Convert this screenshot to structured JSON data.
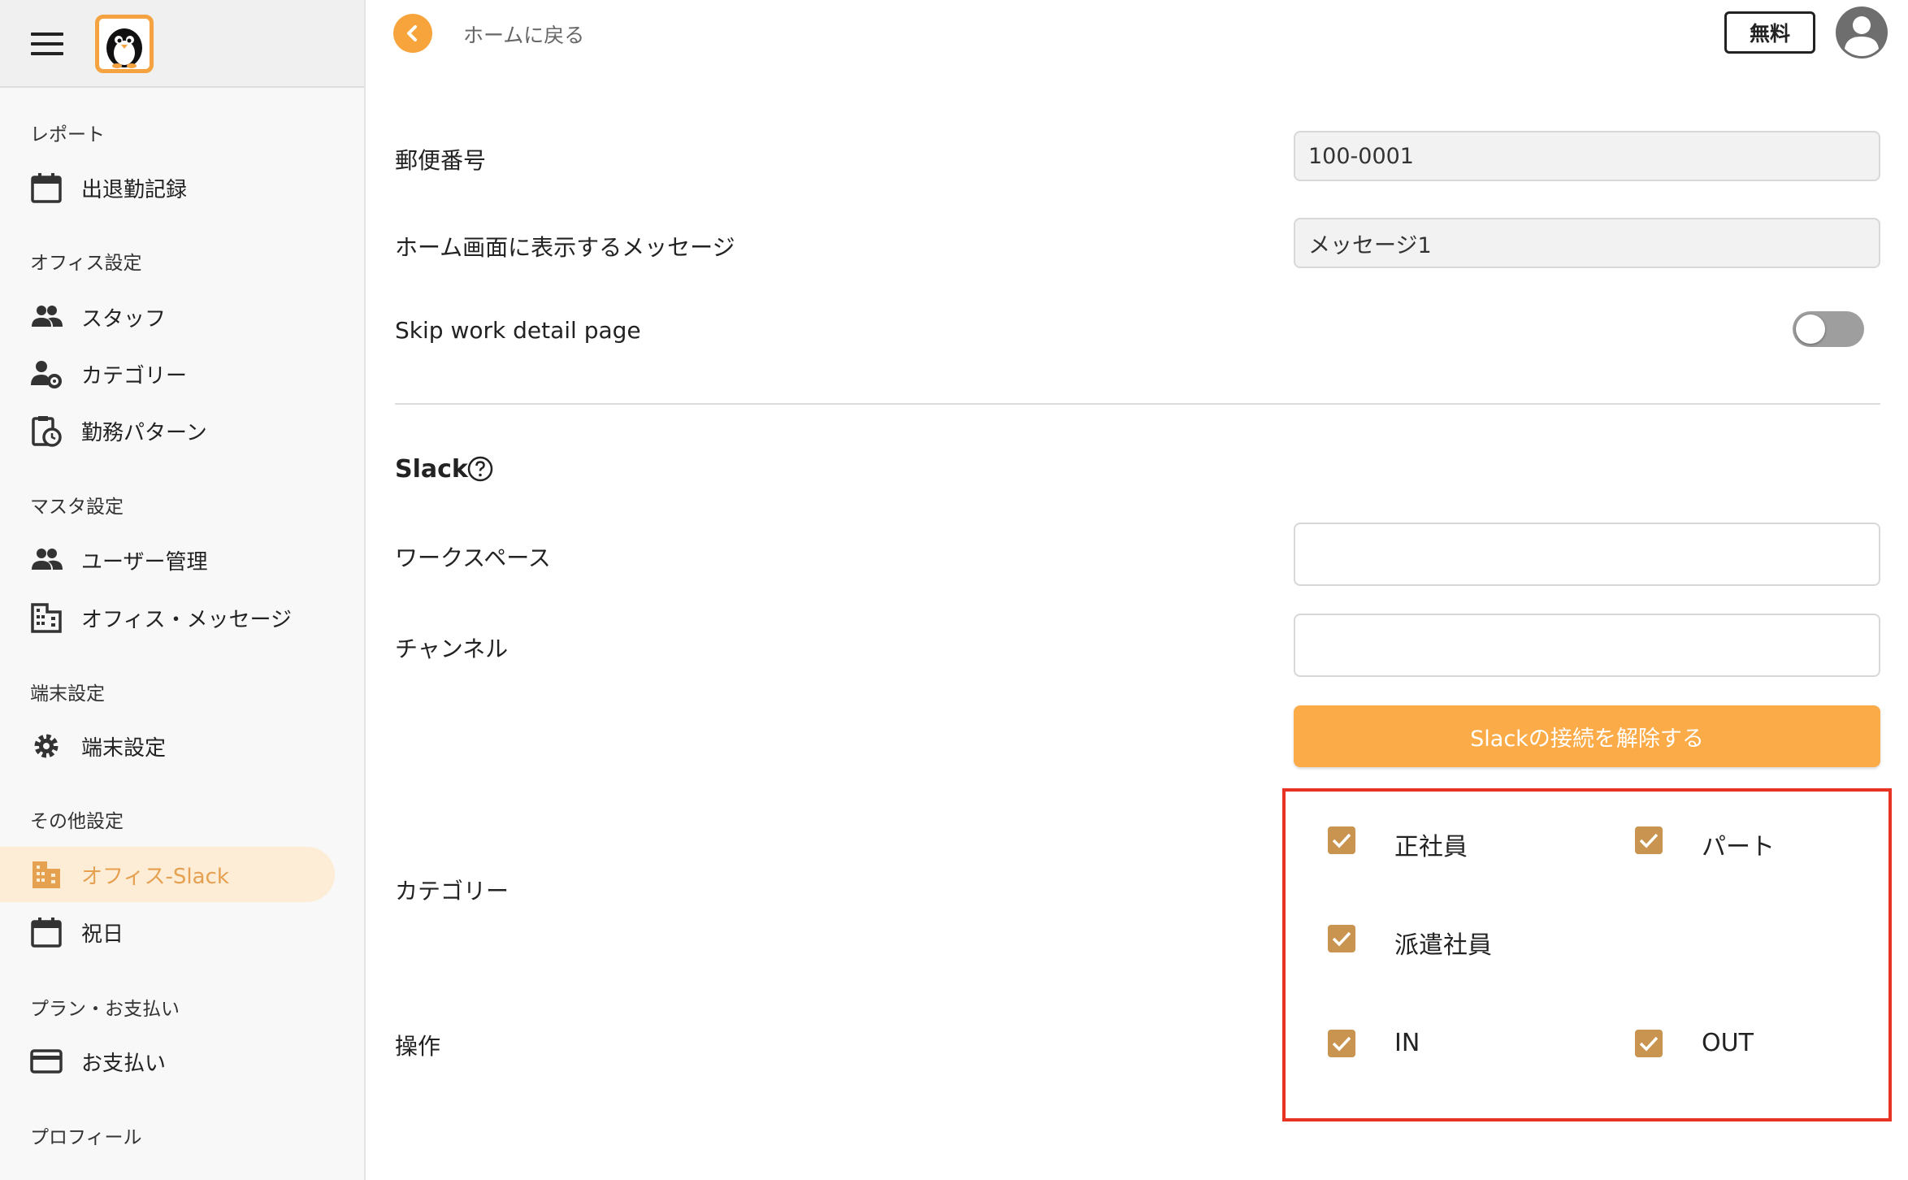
{
  "sidebar": {
    "sections": [
      {
        "label": "レポート"
      },
      {
        "label": "オフィス設定"
      },
      {
        "label": "マスタ設定"
      },
      {
        "label": "端末設定"
      },
      {
        "label": "その他設定"
      },
      {
        "label": "プラン・お支払い"
      },
      {
        "label": "プロフィール"
      }
    ],
    "items": [
      {
        "label": "出退勤記録",
        "icon": "calendar-icon"
      },
      {
        "label": "スタッフ",
        "icon": "people-icon"
      },
      {
        "label": "カテゴリー",
        "icon": "person-gear-icon"
      },
      {
        "label": "勤務パターン",
        "icon": "clipboard-clock-icon"
      },
      {
        "label": "ユーザー管理",
        "icon": "people-icon"
      },
      {
        "label": "オフィス・メッセージ",
        "icon": "building-icon"
      },
      {
        "label": "端末設定",
        "icon": "gear-icon"
      },
      {
        "label": "オフィス-Slack",
        "icon": "building-icon",
        "active": true
      },
      {
        "label": "祝日",
        "icon": "calendar-icon"
      },
      {
        "label": "お支払い",
        "icon": "credit-card-icon"
      }
    ]
  },
  "header": {
    "back_label": "ホームに戻る",
    "plan_label": "無料"
  },
  "form": {
    "postal_label": "郵便番号",
    "postal_value": "100-0001",
    "message_label": "ホーム画面に表示するメッセージ",
    "message_value": "メッセージ1",
    "skip_label": "Skip work detail page",
    "skip_enabled": false
  },
  "slack": {
    "title": "Slack",
    "workspace_label": "ワークスペース",
    "workspace_value": "",
    "channel_label": "チャンネル",
    "channel_value": "",
    "disconnect_label": "Slackの接続を解除する",
    "category_label": "カテゴリー",
    "categories": [
      {
        "label": "正社員",
        "checked": true
      },
      {
        "label": "パート",
        "checked": true
      },
      {
        "label": "派遣社員",
        "checked": true
      }
    ],
    "operation_label": "操作",
    "operations": [
      {
        "label": "IN",
        "checked": true
      },
      {
        "label": "OUT",
        "checked": true
      }
    ]
  },
  "colors": {
    "accent": "#f7a43c",
    "active_bg": "#fdecd6",
    "checkbox": "#c9944f",
    "highlight": "#e63323"
  }
}
